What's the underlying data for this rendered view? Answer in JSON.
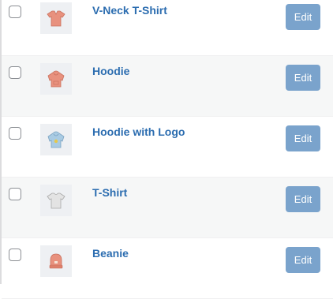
{
  "products": [
    {
      "name": "V-Neck T-Shirt",
      "thumb_icon": "vneck-tshirt-icon",
      "thumb_color": "#e8917e",
      "edit_label": "Edit"
    },
    {
      "name": "Hoodie",
      "thumb_icon": "hoodie-icon",
      "thumb_color": "#e8917e",
      "edit_label": "Edit"
    },
    {
      "name": "Hoodie with Logo",
      "thumb_icon": "hoodie-logo-icon",
      "thumb_color": "#a9cbe3",
      "edit_label": "Edit"
    },
    {
      "name": "T-Shirt",
      "thumb_icon": "tshirt-icon",
      "thumb_color": "#d9d9d9",
      "edit_label": "Edit"
    },
    {
      "name": "Beanie",
      "thumb_icon": "beanie-icon",
      "thumb_color": "#e8917e",
      "edit_label": "Edit"
    }
  ],
  "colors": {
    "link": "#2c6db0",
    "button": "#7aa3cc",
    "row_alt": "#f6f7f7"
  }
}
